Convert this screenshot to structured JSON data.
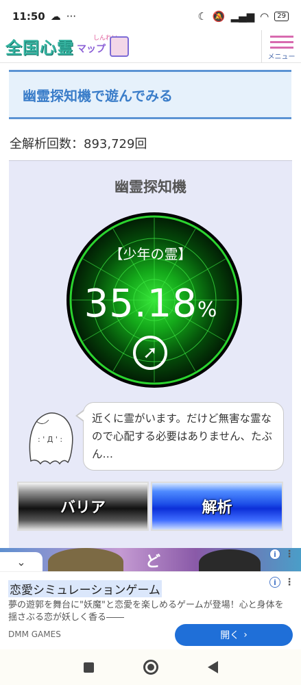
{
  "status_bar": {
    "time": "11:50",
    "left_icons": [
      "weather-icon",
      "more-dots-icon"
    ],
    "right_icons": [
      "moon-icon",
      "mute-icon",
      "signal-icon",
      "wifi-icon"
    ],
    "battery": "29"
  },
  "header": {
    "logo_text": "全国心霊",
    "logo_ruby": "しんれい",
    "logo_map": "マップ",
    "menu_label": "メニュー"
  },
  "section": {
    "title": "幽霊探知機で遊んでみる"
  },
  "stats": {
    "total_analyses": "全解析回数：893,729回"
  },
  "detector": {
    "title": "幽霊探知機",
    "label": "【少年の霊】",
    "percent_value": "35.18",
    "percent_unit": "%",
    "arrow_glyph": "➚",
    "message": "近くに霊がいます。だけど無害な霊なので心配する必要はありません、たぶん…",
    "barrier_button": "バリア",
    "analyze_button": "解析",
    "colors": {
      "radar_green": "#1fbf2a",
      "radar_dark": "#032a05",
      "barrier": "#222222",
      "analyze": "#1d4fe8"
    }
  },
  "ad_banner": {
    "glyph": "ど",
    "collapse_icon": "⌄"
  },
  "ad": {
    "title": "恋愛シミュレーションゲーム",
    "description": "夢の遊郭を舞台に\"妖魔\"と恋愛を楽しめるゲームが登場！心と身体を揺さぶる恋が妖しく香る――",
    "brand": "DMM GAMES",
    "open_label": "開く",
    "open_icon": "›",
    "info_glyph": "i",
    "menu_glyph": "⋮"
  },
  "nav": {
    "items": [
      "recent-apps-icon",
      "home-icon",
      "back-icon"
    ]
  }
}
